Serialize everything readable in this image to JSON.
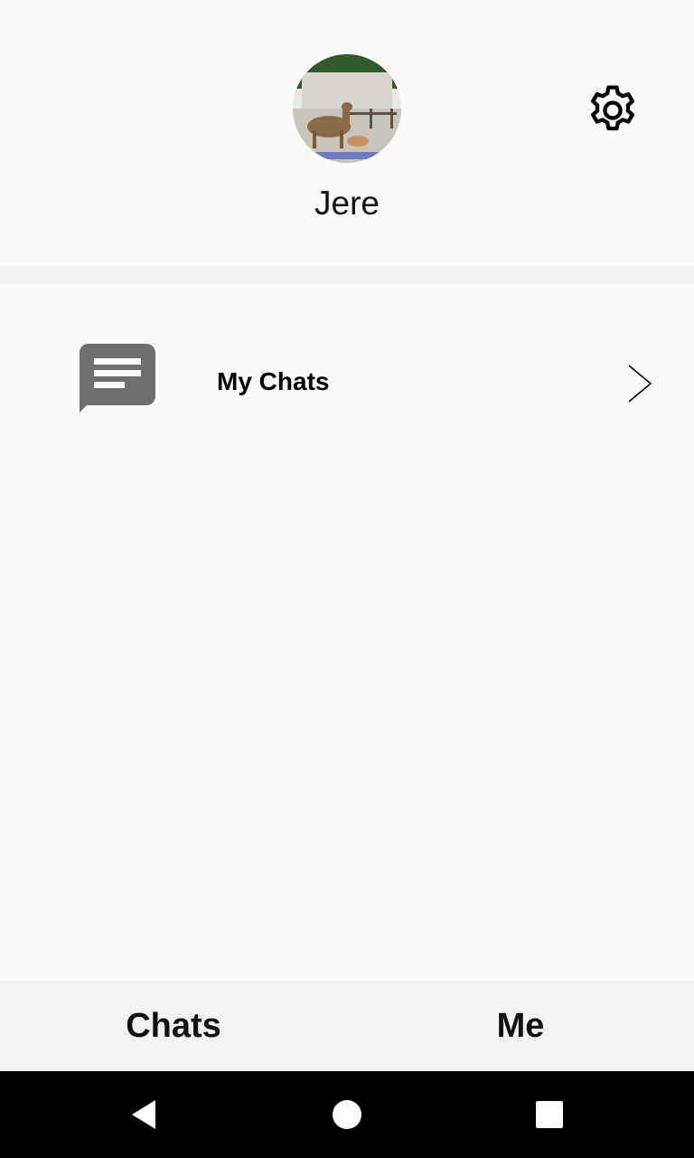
{
  "profile": {
    "username": "Jere",
    "avatar_icon": "profile-photo"
  },
  "settings": {
    "icon": "gear-icon"
  },
  "menu": {
    "items": [
      {
        "label": "My Chats",
        "icon": "chat-bubble-icon"
      }
    ]
  },
  "tabs": {
    "items": [
      {
        "label": "Chats"
      },
      {
        "label": "Me"
      }
    ],
    "active": "Me"
  },
  "system_nav": {
    "buttons": [
      "back",
      "home",
      "recents"
    ]
  },
  "colors": {
    "background": "#fafafa",
    "divider": "#f2f2f2",
    "tab_bar": "#f3f3f3",
    "icon_gray": "#6f6f6f",
    "nav_bar": "#000000"
  }
}
